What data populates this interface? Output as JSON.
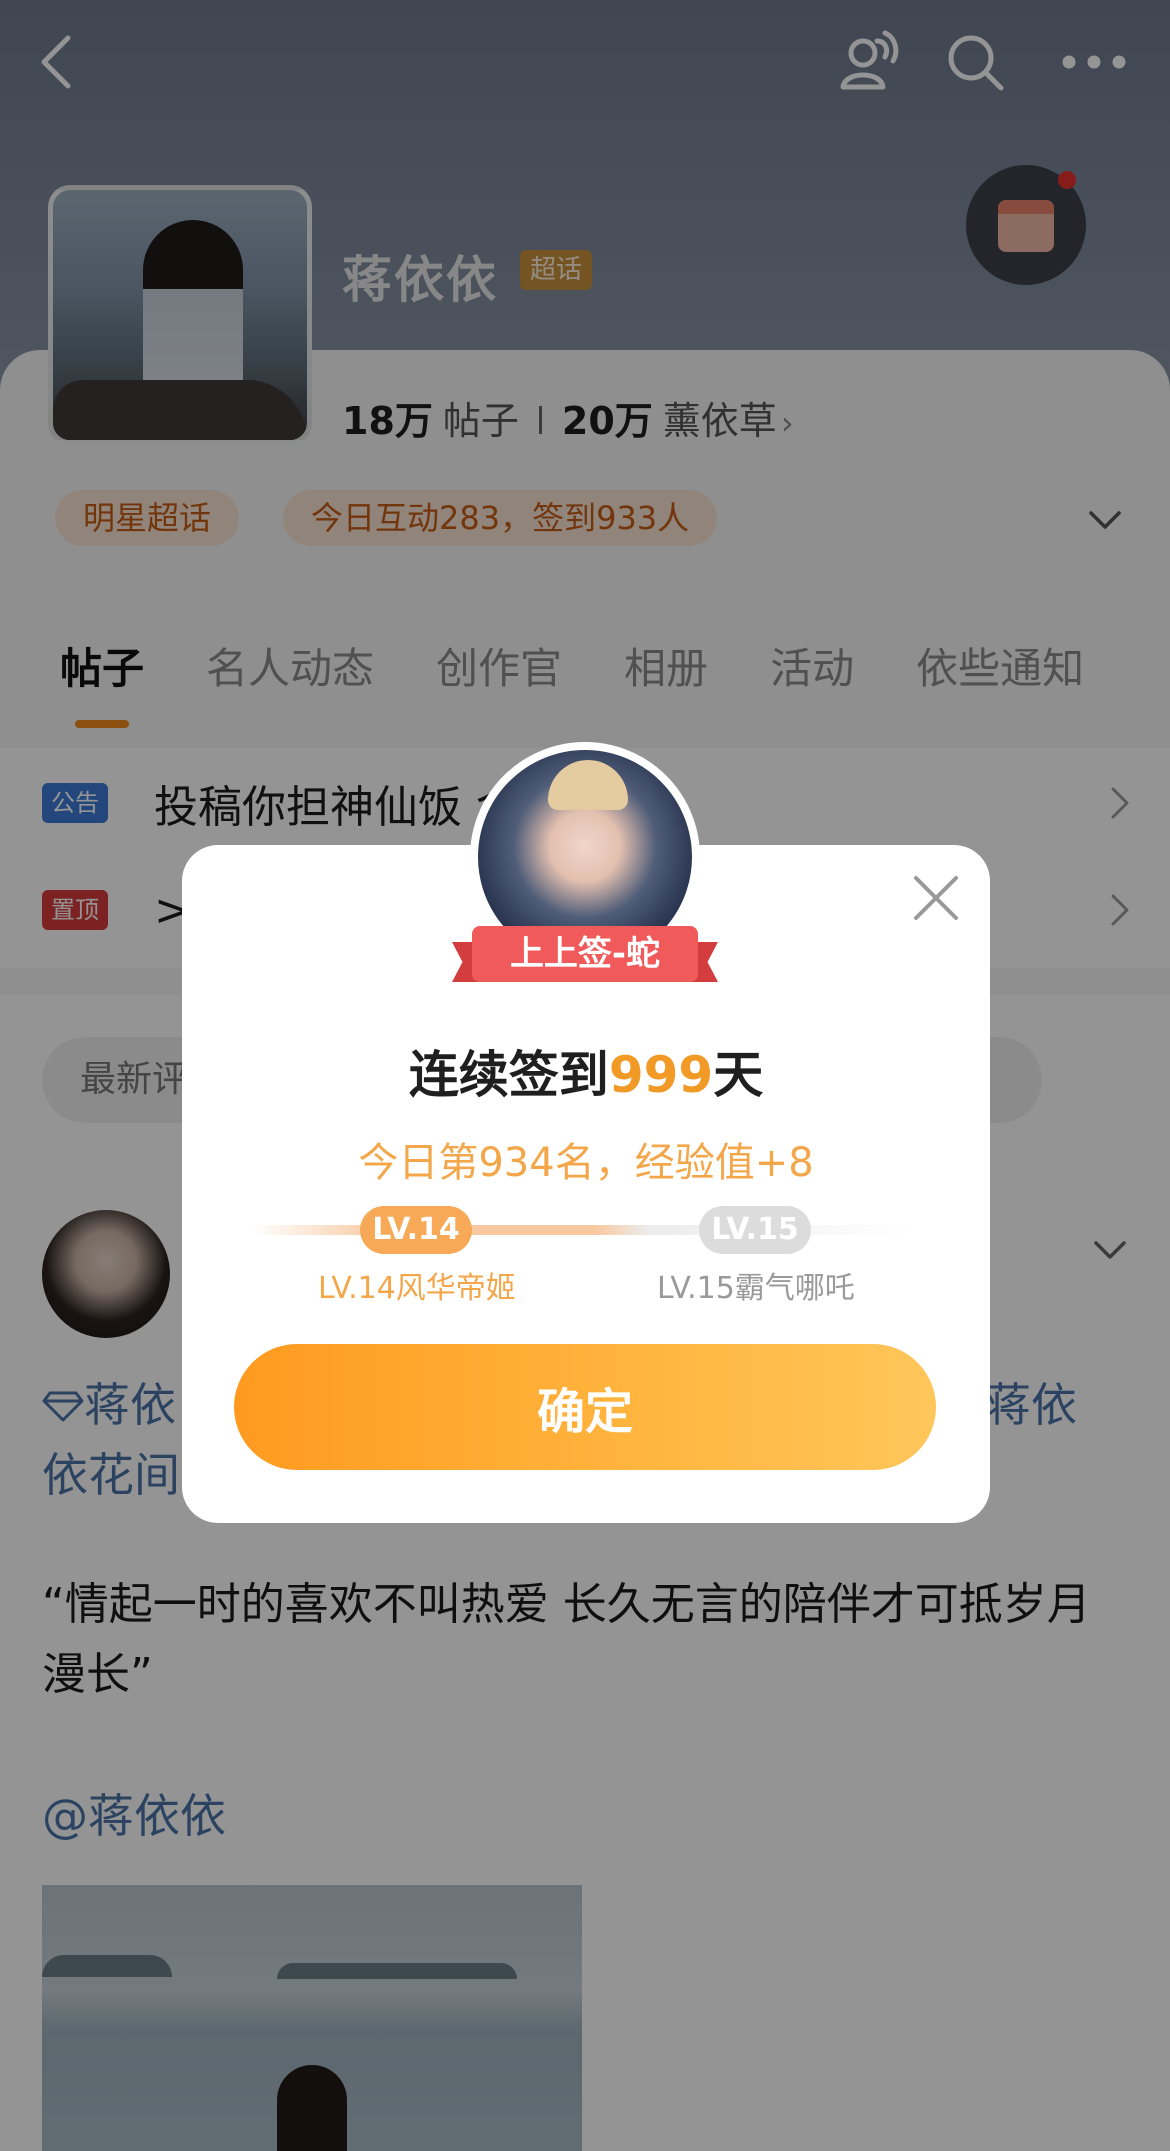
{
  "header": {
    "title": "蒋依依",
    "badge": "超话",
    "posts_count": "18万",
    "posts_label": "帖子",
    "fans_count": "20万",
    "fans_label": "薰依草",
    "fans_arrow": "›"
  },
  "chips": [
    "明星超话",
    "今日互动283，签到933人"
  ],
  "tabs": [
    "帖子",
    "名人动态",
    "创作官",
    "相册",
    "活动",
    "依些通知"
  ],
  "notices": [
    {
      "tag": "公告",
      "tag_color": "#3d7bd8",
      "text": "投稿你担神仙饭                   金推流>>"
    },
    {
      "tag": "置顶",
      "tag_color": "#d83b3b",
      "text": ">"
    }
  ],
  "sort": {
    "label": "最新评"
  },
  "post": {
    "topic_left": "蒋依\n依花间",
    "topic_right": "蒋依",
    "quote": "“情起一时的喜欢不叫热爱 长久无言的陪伴才可抵岁月漫长”",
    "mention": "@蒋依依"
  },
  "modal": {
    "fortune": "上上签-蛇",
    "streak_prefix": "连续签到",
    "streak_days": "999",
    "streak_suffix": "天",
    "rank_text": "今日第934名，经验值+8",
    "level_current": "LV.14",
    "level_current_name": "LV.14风华帝姬",
    "level_next": "LV.15",
    "level_next_name": "LV.15霸气哪吒",
    "confirm_label": "确定"
  },
  "icons": [
    "back-icon",
    "friends-icon",
    "search-icon",
    "more-icon",
    "calendar-checkin-icon",
    "close-icon",
    "chevron-down-icon",
    "chevron-right-icon",
    "diamond-icon"
  ],
  "colors": {
    "accent": "#f29a26",
    "link": "#4b72a7",
    "chip_bg": "#f8e3d5",
    "chip_text": "#c75e16"
  }
}
